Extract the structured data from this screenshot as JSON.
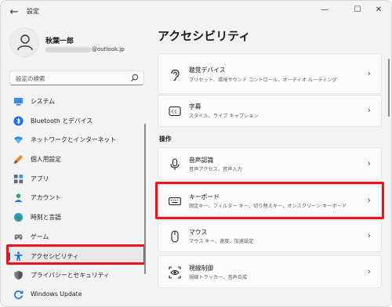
{
  "window": {
    "title": "設定",
    "back_glyph": "←",
    "minimize_glyph": "—",
    "maximize_glyph": "☐",
    "close_glyph": "✕"
  },
  "profile": {
    "name": "秋葉一郎",
    "email_suffix": "@outlook.jp"
  },
  "search": {
    "placeholder": "設定の検索",
    "icon": "search-icon"
  },
  "nav": {
    "items": [
      {
        "label": "システム",
        "icon": "system-icon"
      },
      {
        "label": "Bluetooth とデバイス",
        "icon": "bluetooth-icon"
      },
      {
        "label": "ネットワークとインターネット",
        "icon": "network-icon"
      },
      {
        "label": "個人用設定",
        "icon": "personalization-icon"
      },
      {
        "label": "アプリ",
        "icon": "apps-icon"
      },
      {
        "label": "アカウント",
        "icon": "account-icon"
      },
      {
        "label": "時刻と言語",
        "icon": "time-language-icon"
      },
      {
        "label": "ゲーム",
        "icon": "gaming-icon"
      },
      {
        "label": "アクセシビリティ",
        "icon": "accessibility-icon",
        "selected": true
      },
      {
        "label": "プライバシーとセキュリティ",
        "icon": "privacy-icon"
      },
      {
        "label": "Windows Update",
        "icon": "windows-update-icon"
      }
    ]
  },
  "main": {
    "title": "アクセシビリティ",
    "cards_top": [
      {
        "title": "聴覚デバイス",
        "subtitle": "プリセット、環境サウンド コントロール、オーディオ ルーティング",
        "icon": "hearing-icon"
      },
      {
        "title": "字幕",
        "subtitle": "スタイル、ライブ キャプション",
        "icon": "captions-icon"
      }
    ],
    "section": "操作",
    "cards_interaction": [
      {
        "title": "音声認識",
        "subtitle": "音声アクセス、音声入力",
        "icon": "microphone-icon"
      },
      {
        "title": "キーボード",
        "subtitle": "固定キー、フィルター キー、切り替えキー、オンスクリーン キーボード",
        "icon": "keyboard-icon"
      },
      {
        "title": "マウス",
        "subtitle": "マウス キー、速度、加速設定",
        "icon": "mouse-icon"
      },
      {
        "title": "視線制御",
        "subtitle": "視線トラッカー、音声合成",
        "icon": "eye-control-icon"
      }
    ],
    "chevron": "›"
  },
  "colors": {
    "accent": "#0067c0",
    "highlight": "#e8131b"
  }
}
